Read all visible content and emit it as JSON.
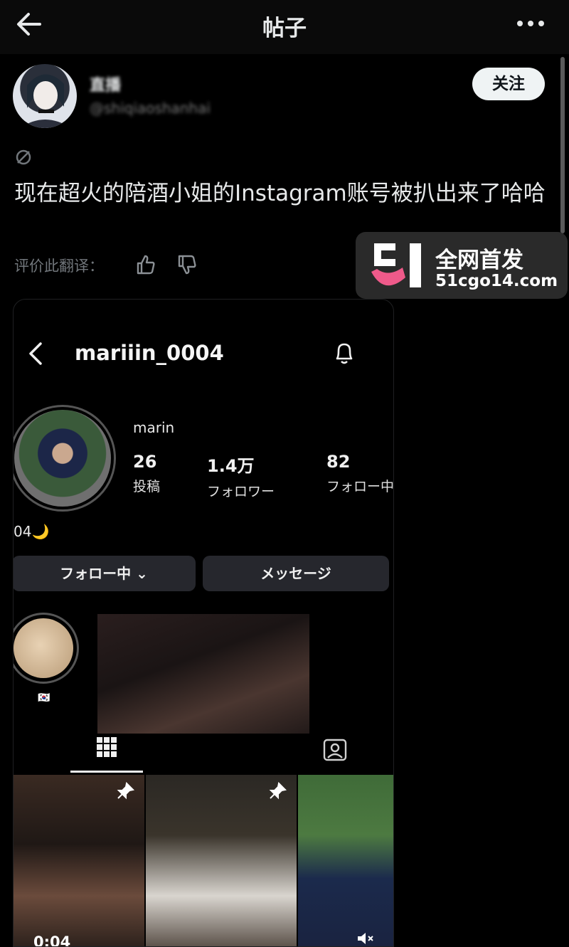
{
  "header": {
    "title": "帖子"
  },
  "author": {
    "name": "直播",
    "handle": "@shiqiaoshanhai",
    "follow_label": "关注"
  },
  "post": {
    "text": "现在超火的陪酒小姐的Instagram账号被扒出来了哈哈",
    "translate_label": "评价此翻译："
  },
  "watermark": {
    "title": "全网首发",
    "url": "51cgo14.com"
  },
  "instagram": {
    "username": "mariiin_0004",
    "display_name": "marin",
    "stats": [
      {
        "value": "26",
        "label": "投稿"
      },
      {
        "value": "1.4万",
        "label": "フォロワー"
      },
      {
        "value": "82",
        "label": "フォロー中"
      }
    ],
    "bio": "04🌙",
    "following_button": "フォロー中 ⌄",
    "message_button": "メッセージ",
    "highlight_flag": "🇰🇷",
    "tile_caption": "0:04"
  },
  "colors": {
    "background": "#000000",
    "follow_button_bg": "#eff3f4",
    "watermark_bg": "#2a2a2a",
    "logo_pink": "#ef5a8a"
  }
}
